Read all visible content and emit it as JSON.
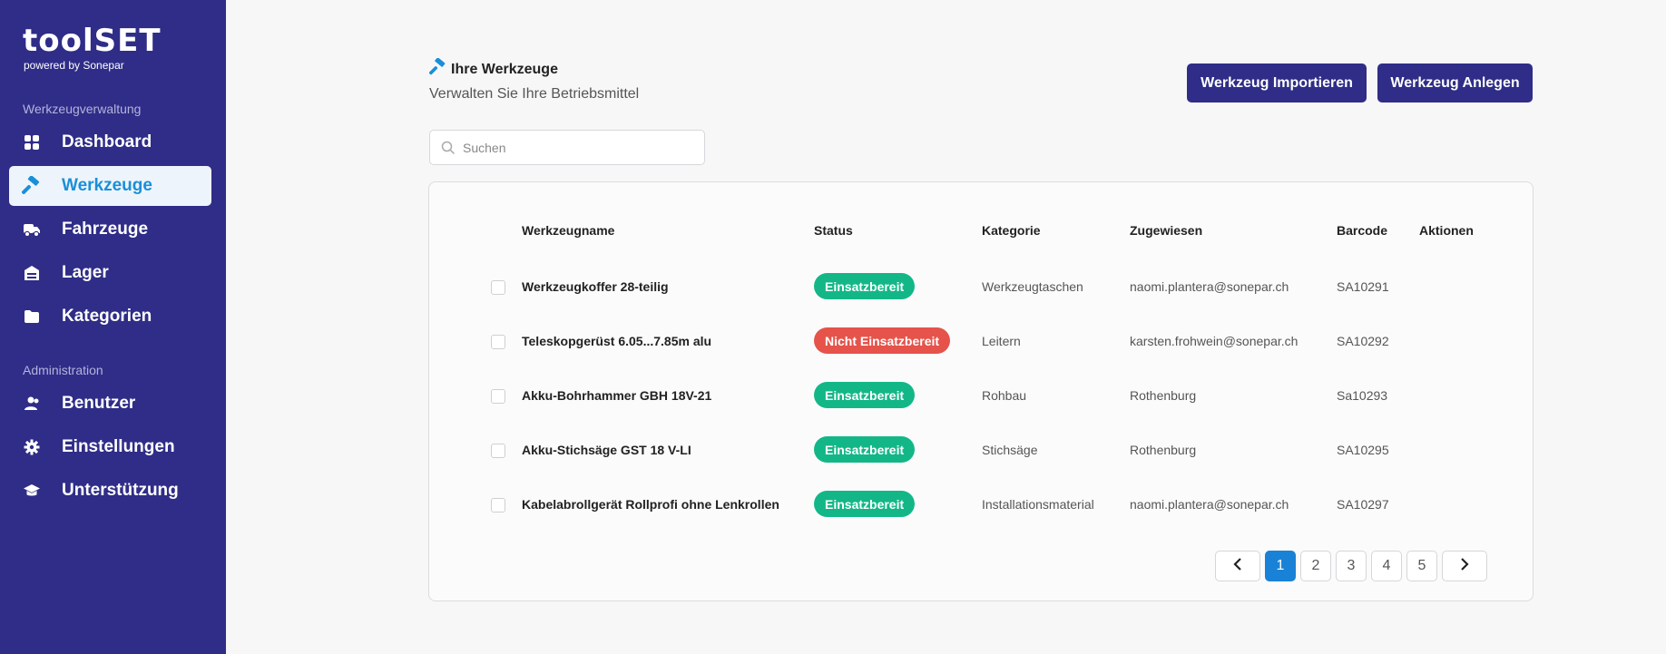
{
  "brand": {
    "name": "toolSET",
    "tagline": "powered by Sonepar"
  },
  "sidebar": {
    "section_main": "Werkzeugverwaltung",
    "section_admin": "Administration",
    "items": [
      {
        "label": "Dashboard",
        "icon": "dashboard-icon"
      },
      {
        "label": "Werkzeuge",
        "icon": "hammer-icon",
        "active": true
      },
      {
        "label": "Fahrzeuge",
        "icon": "truck-icon"
      },
      {
        "label": "Lager",
        "icon": "warehouse-icon"
      },
      {
        "label": "Kategorien",
        "icon": "folder-icon"
      },
      {
        "label": "Benutzer",
        "icon": "users-icon"
      },
      {
        "label": "Einstellungen",
        "icon": "gear-icon"
      },
      {
        "label": "Unterstützung",
        "icon": "graduation-cap-icon"
      }
    ]
  },
  "header": {
    "title": "Ihre Werkzeuge",
    "subtitle": "Verwalten Sie Ihre Betriebsmittel",
    "import_label": "Werkzeug Importieren",
    "create_label": "Werkzeug Anlegen"
  },
  "search": {
    "placeholder": "Suchen",
    "value": ""
  },
  "table": {
    "columns": [
      "Werkzeugname",
      "Status",
      "Kategorie",
      "Zugewiesen",
      "Barcode",
      "Aktionen"
    ],
    "rows": [
      {
        "name": "Werkzeugkoffer 28-teilig",
        "status": "Einsatzbereit",
        "ok": true,
        "category": "Werkzeugtaschen",
        "assigned": "naomi.plantera@sonepar.ch",
        "barcode": "SA10291"
      },
      {
        "name": "Teleskopgerüst 6.05...7.85m alu",
        "status": "Nicht Einsatzbereit",
        "ok": false,
        "category": "Leitern",
        "assigned": "karsten.frohwein@sonepar.ch",
        "barcode": "SA10292"
      },
      {
        "name": "Akku-Bohrhammer GBH 18V-21",
        "status": "Einsatzbereit",
        "ok": true,
        "category": "Rohbau",
        "assigned": "Rothenburg",
        "barcode": "Sa10293"
      },
      {
        "name": "Akku-Stichsäge GST 18 V-LI",
        "status": "Einsatzbereit",
        "ok": true,
        "category": "Stichsäge",
        "assigned": "Rothenburg",
        "barcode": "SA10295"
      },
      {
        "name": "Kabelabrollgerät Rollprofi ohne Lenkrollen",
        "status": "Einsatzbereit",
        "ok": true,
        "category": "Installationsmaterial",
        "assigned": "naomi.plantera@sonepar.ch",
        "barcode": "SA10297"
      }
    ]
  },
  "pagination": {
    "pages": [
      "1",
      "2",
      "3",
      "4",
      "5"
    ],
    "current": "1"
  },
  "colors": {
    "sidebar": "#2f2d87",
    "accent": "#1a8fd8",
    "status_ok": "#13b787",
    "status_bad": "#e5534b",
    "button": "#2f2d87"
  }
}
